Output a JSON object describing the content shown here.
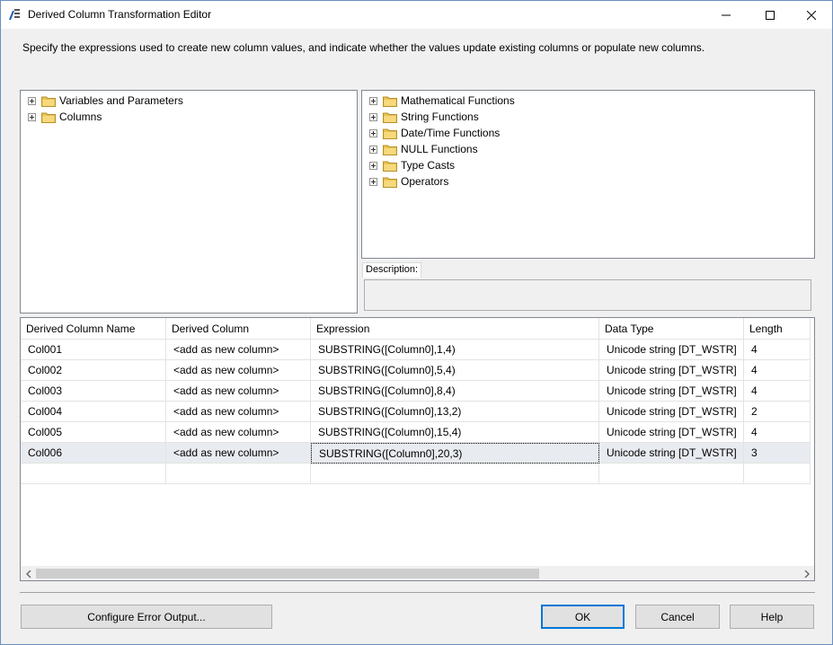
{
  "window": {
    "title": "Derived Column Transformation Editor"
  },
  "instructions": "Specify the expressions used to create new column values, and indicate whether the values update existing columns or populate new columns.",
  "left_tree": [
    {
      "label": "Variables and Parameters",
      "icon": "folder-icon"
    },
    {
      "label": "Columns",
      "icon": "folder-icon"
    }
  ],
  "right_tree": [
    {
      "label": "Mathematical Functions",
      "icon": "folder-icon"
    },
    {
      "label": "String Functions",
      "icon": "folder-icon"
    },
    {
      "label": "Date/Time Functions",
      "icon": "folder-icon"
    },
    {
      "label": "NULL Functions",
      "icon": "folder-icon"
    },
    {
      "label": "Type Casts",
      "icon": "folder-icon"
    },
    {
      "label": "Operators",
      "icon": "folder-icon"
    }
  ],
  "description": {
    "label": "Description:",
    "value": ""
  },
  "grid": {
    "columns": [
      "Derived Column Name",
      "Derived Column",
      "Expression",
      "Data Type",
      "Length"
    ],
    "rows": [
      [
        "Col001",
        "<add as new column>",
        "SUBSTRING([Column0],1,4)",
        "Unicode string [DT_WSTR]",
        "4"
      ],
      [
        "Col002",
        "<add as new column>",
        "SUBSTRING([Column0],5,4)",
        "Unicode string [DT_WSTR]",
        "4"
      ],
      [
        "Col003",
        "<add as new column>",
        "SUBSTRING([Column0],8,4)",
        "Unicode string [DT_WSTR]",
        "4"
      ],
      [
        "Col004",
        "<add as new column>",
        "SUBSTRING([Column0],13,2)",
        "Unicode string [DT_WSTR]",
        "2"
      ],
      [
        "Col005",
        "<add as new column>",
        "SUBSTRING([Column0],15,4)",
        "Unicode string [DT_WSTR]",
        "4"
      ],
      [
        "Col006",
        "<add as new column>",
        "SUBSTRING([Column0],20,3)",
        "Unicode string [DT_WSTR]",
        "3"
      ]
    ],
    "selected_row": 5
  },
  "buttons": {
    "configure_error_output": "Configure Error Output...",
    "ok": "OK",
    "cancel": "Cancel",
    "help": "Help"
  },
  "colors": {
    "accent": "#0078d7",
    "folder": "#e8c253",
    "selection": "#e8ebf0"
  }
}
